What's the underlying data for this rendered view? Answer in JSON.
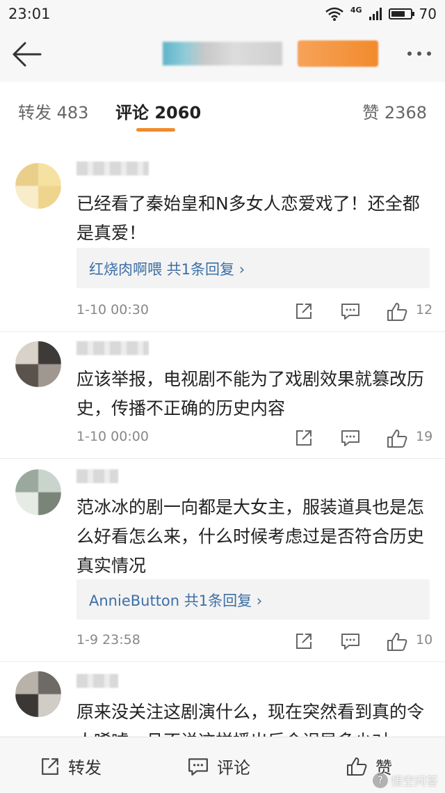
{
  "status_bar": {
    "time": "23:01",
    "network": "4G",
    "battery": "70"
  },
  "tabs": [
    {
      "label": "转发 483"
    },
    {
      "label": "评论 2060"
    },
    {
      "label": "赞 2368"
    }
  ],
  "comments": [
    {
      "text": "已经看了秦始皇和N多女人恋爱戏了！还全都是真爱！",
      "reply": "红烧肉啊喂  共1条回复 ›",
      "date": "1-10 00:30",
      "likes": "12"
    },
    {
      "text": "应该举报，电视剧不能为了戏剧效果就篡改历史，传播不正确的历史内容",
      "date": "1-10 00:00",
      "likes": "19"
    },
    {
      "text": "范冰冰的剧一向都是大女主，服装道具也是怎么好看怎么来，什么时候考虑过是否符合历史真实情况",
      "reply": "AnnieButton  共1条回复 ›",
      "date": "1-9 23:58",
      "likes": "10"
    },
    {
      "text": "原来没关注这剧演什么，现在突然看到真的令人唏嘘，且不说这样播出后会误导多少对"
    }
  ],
  "bottom_bar": {
    "repost": "转发",
    "comment": "评论",
    "like": "赞"
  },
  "watermark": "悟空问答",
  "colors": {
    "accent": "#f28a2c",
    "link": "#3d6fa5"
  }
}
